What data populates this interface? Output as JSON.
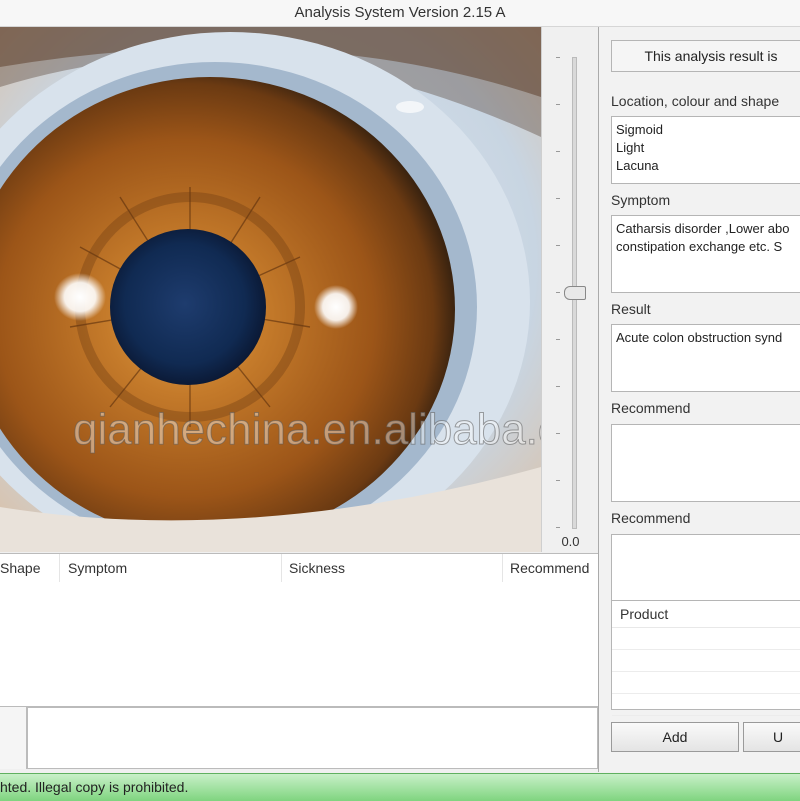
{
  "window": {
    "title": "Analysis System Version 2.15 A"
  },
  "image_view": {
    "watermark": "qianhechina.en.alibaba.com"
  },
  "zoom": {
    "value": "0.0",
    "level": 0.5
  },
  "table": {
    "columns": [
      "Shape",
      "Symptom",
      "Sickness",
      "Recommend"
    ],
    "rows": []
  },
  "analysis": {
    "banner": "This analysis result is",
    "location_label": "Location, colour and shape",
    "location_lines": [
      "Sigmoid",
      "Light",
      "Lacuna"
    ],
    "symptom_label": "Symptom",
    "symptom_lines": [
      "Catharsis disorder ,Lower abo",
      "constipation exchange etc. S"
    ],
    "result_label": "Result",
    "result_lines": [
      "Acute colon obstruction synd"
    ],
    "recommend1_label": "Recommend",
    "recommend2_label": "Recommend",
    "product_header": "Product"
  },
  "buttons": {
    "add": "Add",
    "update": "U"
  },
  "status": {
    "text": "hted. Illegal copy is prohibited."
  }
}
